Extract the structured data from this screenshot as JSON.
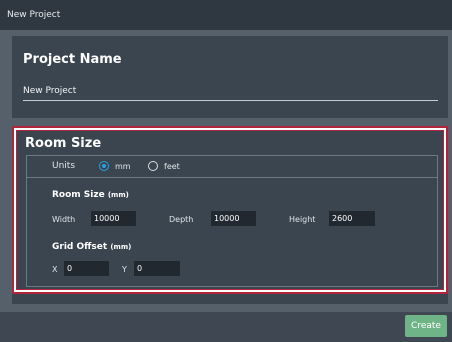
{
  "window": {
    "title": "New Project"
  },
  "project_name": {
    "heading": "Project Name",
    "value": "New Project"
  },
  "room_size": {
    "heading": "Room Size",
    "units": {
      "label": "Units",
      "options": [
        {
          "label": "mm",
          "selected": true
        },
        {
          "label": "feet",
          "selected": false
        }
      ]
    },
    "dimensions": {
      "heading": "Room Size",
      "unit": "(mm)",
      "width_label": "Width",
      "width_value": "10000",
      "depth_label": "Depth",
      "depth_value": "10000",
      "height_label": "Height",
      "height_value": "2600"
    },
    "grid_offset": {
      "heading": "Grid Offset",
      "unit": "(mm)",
      "x_label": "X",
      "x_value": "0",
      "y_label": "Y",
      "y_value": "0"
    }
  },
  "footer": {
    "create_label": "Create"
  },
  "colors": {
    "accent": "#2a9fe0",
    "highlight_border": "#b3233a",
    "create_button": "#6fb487",
    "panel": "#3b4550"
  }
}
